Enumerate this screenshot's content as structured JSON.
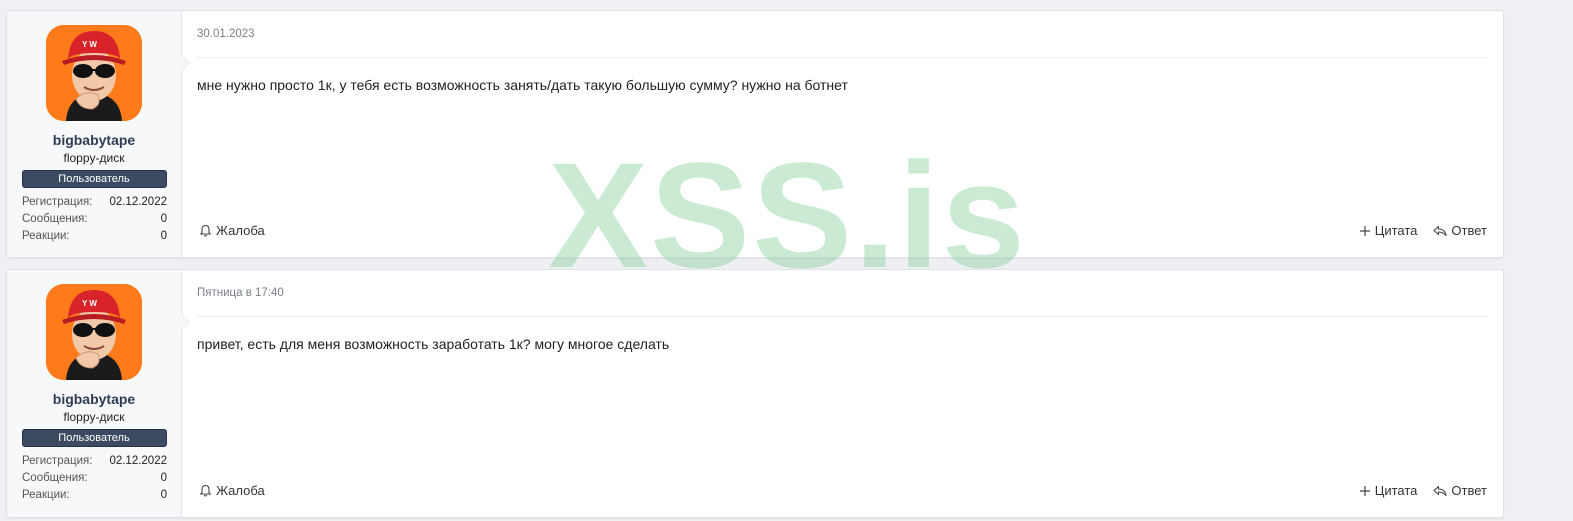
{
  "posts": [
    {
      "username": "bigbabytape",
      "user_title": "floppy-диск",
      "banner": "Пользователь",
      "stats": [
        {
          "label": "Регистрация:",
          "value": "02.12.2022"
        },
        {
          "label": "Сообщения:",
          "value": "0"
        },
        {
          "label": "Реакции:",
          "value": "0"
        }
      ],
      "date": "30.01.2023",
      "message": "мне нужно просто 1к, у тебя есть возможность занять/дать такую большую сумму? нужно на ботнет",
      "report_label": "Жалоба",
      "quote_label": "Цитата",
      "reply_label": "Ответ"
    },
    {
      "username": "bigbabytape",
      "user_title": "floppy-диск",
      "banner": "Пользователь",
      "stats": [
        {
          "label": "Регистрация:",
          "value": "02.12.2022"
        },
        {
          "label": "Сообщения:",
          "value": "0"
        },
        {
          "label": "Реакции:",
          "value": "0"
        }
      ],
      "date": "Пятница в 17:40",
      "message": "привет, есть для меня возможность заработать 1к? могу многое сделать",
      "report_label": "Жалоба",
      "quote_label": "Цитата",
      "reply_label": "Ответ"
    }
  ],
  "watermark": "XSS.is",
  "colors": {
    "banner_bg": "#3d4b62",
    "username": "#2f3c55",
    "avatar_bg": "#ff7a1a",
    "watermark": "#83cd97"
  },
  "icons": {
    "report": "bell-icon",
    "quote": "plus-icon",
    "reply": "reply-arrow-icon"
  }
}
